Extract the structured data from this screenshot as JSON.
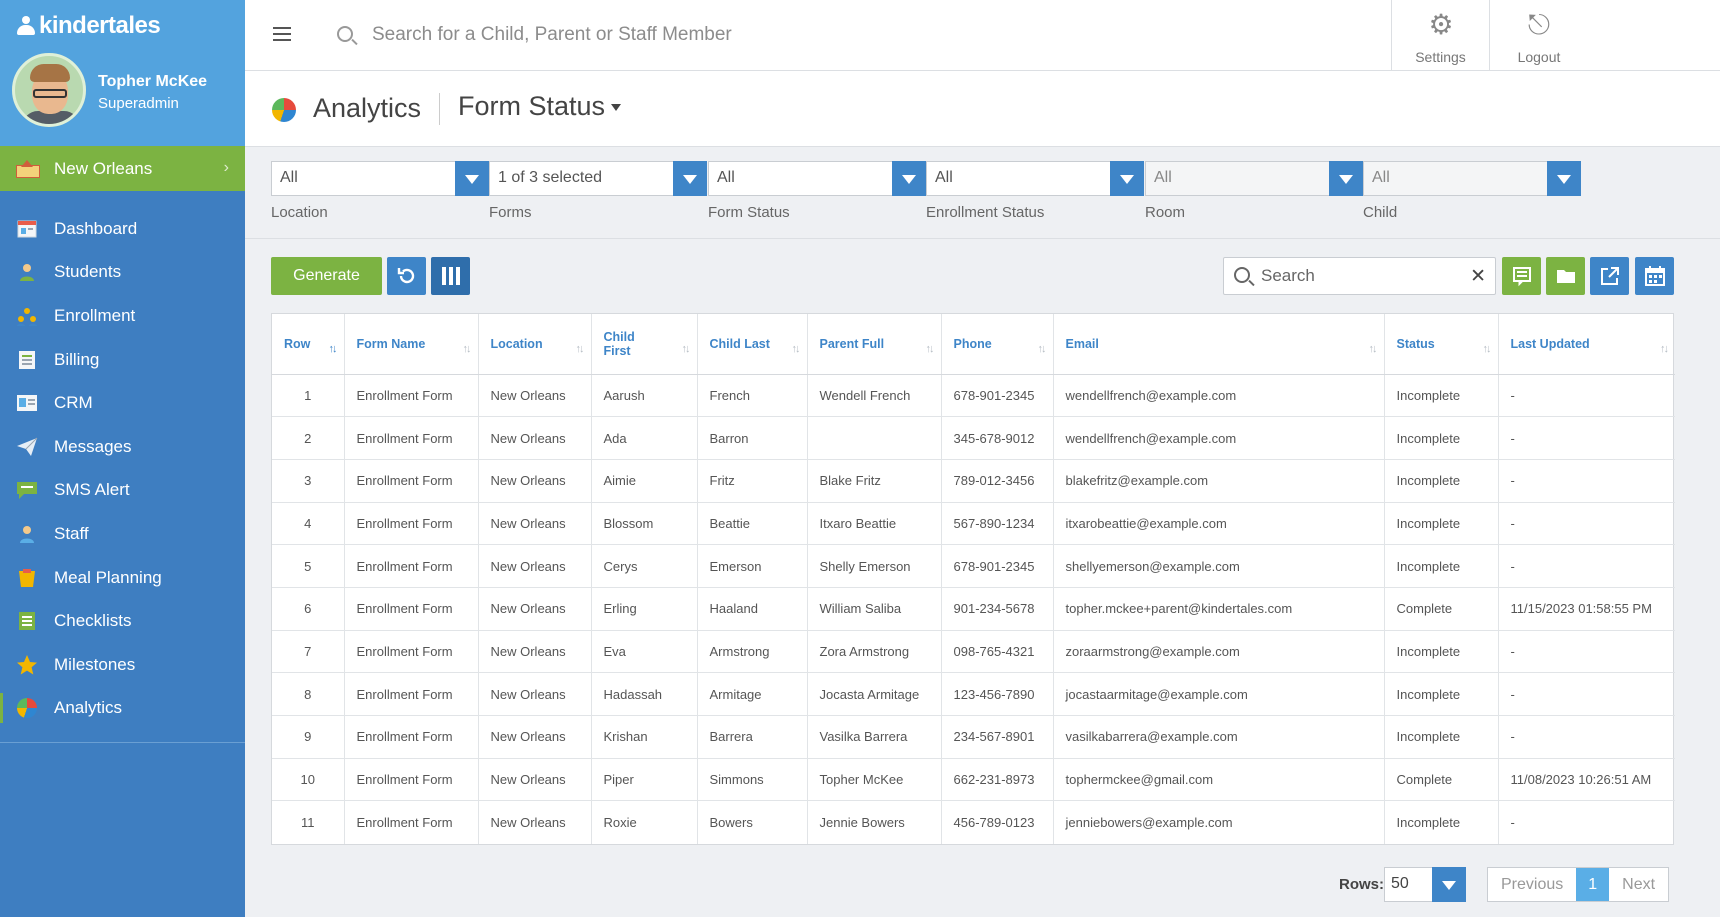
{
  "brand": {
    "logo_text": "kindertales"
  },
  "user": {
    "name": "Topher McKee",
    "role": "Superadmin"
  },
  "location_bar": {
    "label": "New Orleans"
  },
  "sidebar": {
    "items": [
      {
        "label": "Dashboard",
        "icon": "dashboard-icon"
      },
      {
        "label": "Students",
        "icon": "students-icon"
      },
      {
        "label": "Enrollment",
        "icon": "enrollment-icon"
      },
      {
        "label": "Billing",
        "icon": "billing-icon"
      },
      {
        "label": "CRM",
        "icon": "crm-icon"
      },
      {
        "label": "Messages",
        "icon": "paper-plane-icon"
      },
      {
        "label": "SMS Alert",
        "icon": "sms-icon"
      },
      {
        "label": "Staff",
        "icon": "staff-icon"
      },
      {
        "label": "Meal Planning",
        "icon": "meal-icon"
      },
      {
        "label": "Checklists",
        "icon": "checklist-icon"
      },
      {
        "label": "Milestones",
        "icon": "star-icon"
      },
      {
        "label": "Analytics",
        "icon": "pie-chart-icon",
        "active": true
      }
    ]
  },
  "topbar": {
    "search_placeholder": "Search for a Child, Parent or Staff Member",
    "settings_label": "Settings",
    "logout_label": "Logout"
  },
  "title": {
    "section": "Analytics",
    "report": "Form Status"
  },
  "filters": [
    {
      "value": "All",
      "label": "Location"
    },
    {
      "value": "1 of 3 selected",
      "label": "Forms"
    },
    {
      "value": "All",
      "label": "Form Status"
    },
    {
      "value": "All",
      "label": "Enrollment Status"
    },
    {
      "value": "All",
      "label": "Room"
    },
    {
      "value": "All",
      "label": "Child"
    }
  ],
  "toolbar": {
    "generate_label": "Generate",
    "search_placeholder": "Search"
  },
  "table": {
    "columns": [
      "Row",
      "Form Name",
      "Location",
      "Child First",
      "Child Last",
      "Parent Full",
      "Phone",
      "Email",
      "Status",
      "Last Updated"
    ],
    "rows": [
      [
        "1",
        "Enrollment Form",
        "New Orleans",
        "Aarush",
        "French",
        "Wendell French",
        "678-901-2345",
        "wendellfrench@example.com",
        "Incomplete",
        "-"
      ],
      [
        "2",
        "Enrollment Form",
        "New Orleans",
        "Ada",
        "Barron",
        "",
        "345-678-9012",
        "wendellfrench@example.com",
        "Incomplete",
        "-"
      ],
      [
        "3",
        "Enrollment Form",
        "New Orleans",
        "Aimie",
        "Fritz",
        "Blake Fritz",
        "789-012-3456",
        "blakefritz@example.com",
        "Incomplete",
        "-"
      ],
      [
        "4",
        "Enrollment Form",
        "New Orleans",
        "Blossom",
        "Beattie",
        "Itxaro Beattie",
        "567-890-1234",
        "itxarobeattie@example.com",
        "Incomplete",
        "-"
      ],
      [
        "5",
        "Enrollment Form",
        "New Orleans",
        "Cerys",
        "Emerson",
        "Shelly Emerson",
        "678-901-2345",
        "shellyemerson@example.com",
        "Incomplete",
        "-"
      ],
      [
        "6",
        "Enrollment Form",
        "New Orleans",
        "Erling",
        "Haaland",
        "William Saliba",
        "901-234-5678",
        "topher.mckee+parent@kindertales.com",
        "Complete",
        "11/15/2023 01:58:55 PM"
      ],
      [
        "7",
        "Enrollment Form",
        "New Orleans",
        "Eva",
        "Armstrong",
        "Zora Armstrong",
        "098-765-4321",
        "zoraarmstrong@example.com",
        "Incomplete",
        "-"
      ],
      [
        "8",
        "Enrollment Form",
        "New Orleans",
        "Hadassah",
        "Armitage",
        "Jocasta Armitage",
        "123-456-7890",
        "jocastaarmitage@example.com",
        "Incomplete",
        "-"
      ],
      [
        "9",
        "Enrollment Form",
        "New Orleans",
        "Krishan",
        "Barrera",
        "Vasilka Barrera",
        "234-567-8901",
        "vasilkabarrera@example.com",
        "Incomplete",
        "-"
      ],
      [
        "10",
        "Enrollment Form",
        "New Orleans",
        "Piper",
        "Simmons",
        "Topher McKee",
        "662-231-8973",
        "tophermckee@gmail.com",
        "Complete",
        "11/08/2023 10:26:51 AM"
      ],
      [
        "11",
        "Enrollment Form",
        "New Orleans",
        "Roxie",
        "Bowers",
        "Jennie Bowers",
        "456-789-0123",
        "jenniebowers@example.com",
        "Incomplete",
        "-"
      ]
    ]
  },
  "pagination": {
    "rows_label": "Rows:",
    "rows_value": "50",
    "previous_label": "Previous",
    "current_page": "1",
    "next_label": "Next"
  },
  "colors": {
    "sidebar": "#3e7ec1",
    "sidebar_top": "#53a3de",
    "accent_green": "#7cb342",
    "accent_blue": "#3e85c8"
  }
}
